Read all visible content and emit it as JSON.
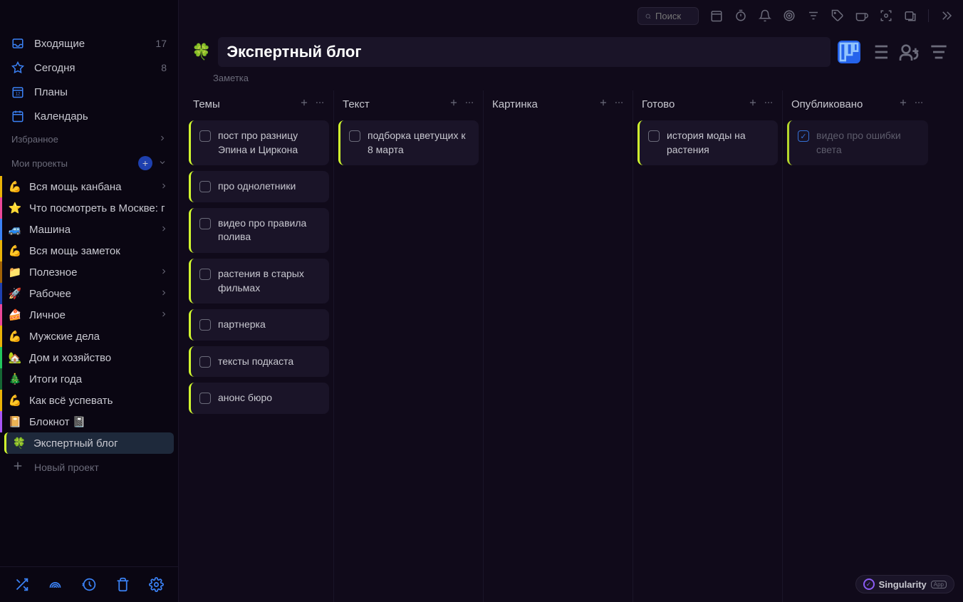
{
  "topbar": {
    "search_placeholder": "Поиск"
  },
  "sidebar": {
    "nav": [
      {
        "label": "Входящие",
        "count": "17"
      },
      {
        "label": "Сегодня",
        "count": "8"
      },
      {
        "label": "Планы",
        "count": ""
      },
      {
        "label": "Календарь",
        "count": ""
      }
    ],
    "favorites_label": "Избранное",
    "projects_label": "Мои проекты",
    "projects": [
      {
        "emoji": "💪",
        "label": "Вся мощь канбана",
        "color": "#eab308",
        "expandable": true
      },
      {
        "emoji": "⭐",
        "label": "Что посмотреть в Москве: г",
        "color": "#ec4899",
        "expandable": false
      },
      {
        "emoji": "🚙",
        "label": "Машина",
        "color": "#3b82f6",
        "expandable": true
      },
      {
        "emoji": "💪",
        "label": "Вся мощь заметок",
        "color": "#eab308",
        "expandable": false
      },
      {
        "emoji": "📁",
        "label": "Полезное",
        "color": "#a16207",
        "expandable": true
      },
      {
        "emoji": "🚀",
        "label": "Рабочее",
        "color": "#1e40af",
        "expandable": true
      },
      {
        "emoji": "🍰",
        "label": "Личное",
        "color": "#ec4899",
        "expandable": true
      },
      {
        "emoji": "💪",
        "label": "Мужские дела",
        "color": "#eab308",
        "expandable": false
      },
      {
        "emoji": "🏡",
        "label": "Дом и хозяйство",
        "color": "#22c55e",
        "expandable": false
      },
      {
        "emoji": "🎄",
        "label": "Итоги года",
        "color": "#166534",
        "expandable": false
      },
      {
        "emoji": "💪",
        "label": "Как всё успевать",
        "color": "#eab308",
        "expandable": false
      },
      {
        "emoji": "📔",
        "label": "Блокнот 📓",
        "color": "#a855f7",
        "expandable": false
      },
      {
        "emoji": "🍀",
        "label": "Экспертный блог",
        "color": "#d1fa2f",
        "expandable": false,
        "active": true
      }
    ],
    "new_project_label": "Новый проект"
  },
  "project": {
    "emoji": "🍀",
    "title": "Экспертный блог",
    "note_label": "Заметка"
  },
  "board": {
    "columns": [
      {
        "name": "Темы",
        "cards": [
          {
            "title": "пост про разницу Эпина и Циркона",
            "done": false
          },
          {
            "title": "про однолетники",
            "done": false
          },
          {
            "title": "видео про правила полива",
            "done": false
          },
          {
            "title": "растения в старых фильмах",
            "done": false
          },
          {
            "title": "партнерка",
            "done": false
          },
          {
            "title": "тексты подкаста",
            "done": false
          },
          {
            "title": "анонс бюро",
            "done": false
          }
        ]
      },
      {
        "name": "Текст",
        "cards": [
          {
            "title": "подборка цветущих к 8 марта",
            "done": false
          }
        ]
      },
      {
        "name": "Картинка",
        "cards": []
      },
      {
        "name": "Готово",
        "cards": [
          {
            "title": "история моды на растения",
            "done": false
          }
        ]
      },
      {
        "name": "Опубликовано",
        "cards": [
          {
            "title": "видео про ошибки света",
            "done": true
          }
        ]
      }
    ]
  },
  "brand": {
    "name": "Singularity",
    "tag": "App"
  }
}
